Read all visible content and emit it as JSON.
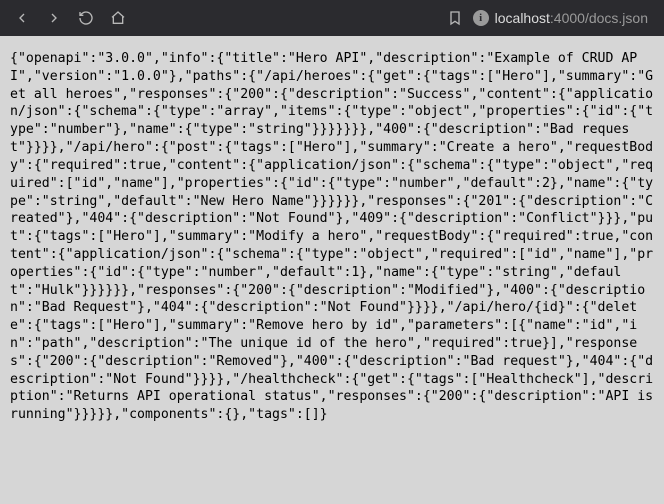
{
  "titlebar": {
    "url": {
      "host": "localhost",
      "port": ":4000",
      "path": "/docs.json"
    }
  },
  "body_text": "{\"openapi\":\"3.0.0\",\"info\":{\"title\":\"Hero API\",\"description\":\"Example of CRUD API\",\"version\":\"1.0.0\"},\"paths\":{\"/api/heroes\":{\"get\":{\"tags\":[\"Hero\"],\"summary\":\"Get all heroes\",\"responses\":{\"200\":{\"description\":\"Success\",\"content\":{\"application/json\":{\"schema\":{\"type\":\"array\",\"items\":{\"type\":\"object\",\"properties\":{\"id\":{\"type\":\"number\"},\"name\":{\"type\":\"string\"}}}}}}},\"400\":{\"description\":\"Bad request\"}}}},\"/api/hero\":{\"post\":{\"tags\":[\"Hero\"],\"summary\":\"Create a hero\",\"requestBody\":{\"required\":true,\"content\":{\"application/json\":{\"schema\":{\"type\":\"object\",\"required\":[\"id\",\"name\"],\"properties\":{\"id\":{\"type\":\"number\",\"default\":2},\"name\":{\"type\":\"string\",\"default\":\"New Hero Name\"}}}}}},\"responses\":{\"201\":{\"description\":\"Created\"},\"404\":{\"description\":\"Not Found\"},\"409\":{\"description\":\"Conflict\"}}},\"put\":{\"tags\":[\"Hero\"],\"summary\":\"Modify a hero\",\"requestBody\":{\"required\":true,\"content\":{\"application/json\":{\"schema\":{\"type\":\"object\",\"required\":[\"id\",\"name\"],\"properties\":{\"id\":{\"type\":\"number\",\"default\":1},\"name\":{\"type\":\"string\",\"default\":\"Hulk\"}}}}}},\"responses\":{\"200\":{\"description\":\"Modified\"},\"400\":{\"description\":\"Bad Request\"},\"404\":{\"description\":\"Not Found\"}}}},\"/api/hero/{id}\":{\"delete\":{\"tags\":[\"Hero\"],\"summary\":\"Remove hero by id\",\"parameters\":[{\"name\":\"id\",\"in\":\"path\",\"description\":\"The unique id of the hero\",\"required\":true}],\"responses\":{\"200\":{\"description\":\"Removed\"},\"400\":{\"description\":\"Bad request\"},\"404\":{\"description\":\"Not Found\"}}}},\"/healthcheck\":{\"get\":{\"tags\":[\"Healthcheck\"],\"description\":\"Returns API operational status\",\"responses\":{\"200\":{\"description\":\"API is  running\"}}}}},\"components\":{},\"tags\":[]}"
}
